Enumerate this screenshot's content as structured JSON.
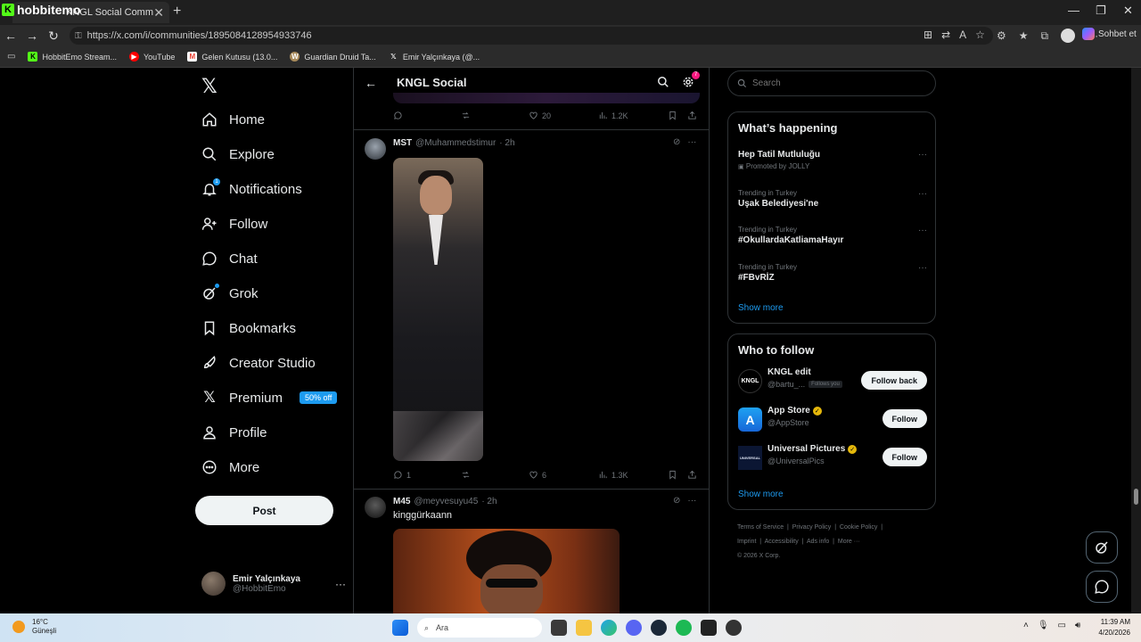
{
  "browser": {
    "channel_name": "hobbitemo",
    "tab_title": "KNGL Social Community / X",
    "url": "https://x.com/i/communities/1895084128954933746",
    "copilot_label": "Sohbet et",
    "bookmarks": [
      {
        "label": "HobbitEmo Stream...",
        "icon": "kick-icon",
        "color": "#53fc18"
      },
      {
        "label": "YouTube",
        "icon": "youtube-icon",
        "color": "#ff0000"
      },
      {
        "label": "Gelen Kutusu (13.0...",
        "icon": "gmail-icon",
        "color": "#ea4335"
      },
      {
        "label": "Guardian Druid Ta...",
        "icon": "wow-icon",
        "color": "#a88a5a"
      },
      {
        "label": "Emir Yalçınkaya (@...",
        "icon": "x-icon",
        "color": "#ffffff"
      }
    ]
  },
  "nav": {
    "items": [
      {
        "label": "Home",
        "icon": "home-icon"
      },
      {
        "label": "Explore",
        "icon": "search-icon"
      },
      {
        "label": "Notifications",
        "icon": "bell-icon",
        "badge": "1"
      },
      {
        "label": "Follow",
        "icon": "add-person-icon"
      },
      {
        "label": "Chat",
        "icon": "chat-bubble-icon"
      },
      {
        "label": "Grok",
        "icon": "grok-icon"
      },
      {
        "label": "Bookmarks",
        "icon": "bookmark-icon"
      },
      {
        "label": "Creator Studio",
        "icon": "rocket-icon"
      },
      {
        "label": "Premium",
        "icon": "x-premium-icon",
        "badge": "50% off"
      },
      {
        "label": "Profile",
        "icon": "person-icon"
      },
      {
        "label": "More",
        "icon": "more-circle-icon"
      }
    ],
    "post_label": "Post",
    "account": {
      "name": "Emir Yalçınkaya",
      "handle": "@HobbitEmo"
    }
  },
  "community": {
    "title": "KNGL Social",
    "settings_badge": "7"
  },
  "tweets": [
    {
      "actions": {
        "reply": "",
        "retweet": "",
        "like": "20",
        "views": "1.2K"
      }
    },
    {
      "name": "MST",
      "handle": "@Muhammedstimur",
      "time": "· 2h",
      "actions": {
        "reply": "1",
        "retweet": "",
        "like": "6",
        "views": "1.3K"
      }
    },
    {
      "name": "M45",
      "handle": "@meyvesuyu45",
      "time": "· 2h",
      "text": "kinggürkaann"
    }
  ],
  "right": {
    "search_placeholder": "Search",
    "happening_title": "What’s happening",
    "trends": [
      {
        "context": "Promoted by JOLLY",
        "title": "Hep Tatil Mutluluğu",
        "promoted": true
      },
      {
        "context": "Trending in Turkey",
        "title": "Uşak Belediyesi'ne"
      },
      {
        "context": "Trending in Turkey",
        "title": "#OkullardaKatliamaHayır"
      },
      {
        "context": "Trending in Turkey",
        "title": "#FBvRİZ"
      }
    ],
    "show_more": "Show more",
    "wtf_title": "Who to follow",
    "who_to_follow": [
      {
        "name": "KNGL edit",
        "handle": "@bartu_...",
        "follows_you": "Follows you",
        "button": "Follow back",
        "avatar_text": "KNGL",
        "verified": false
      },
      {
        "name": "App Store",
        "handle": "@AppStore",
        "button": "Follow",
        "verified": true
      },
      {
        "name": "Universal Pictures",
        "handle": "@UniversalPics",
        "button": "Follow",
        "avatar_text": "UNIVERSAL",
        "verified": true
      }
    ],
    "footer": [
      "Terms of Service",
      "Privacy Policy",
      "Cookie Policy",
      "Imprint",
      "Accessibility",
      "Ads info",
      "More ···",
      "© 2026 X Corp."
    ]
  },
  "taskbar": {
    "temp": "16°C",
    "weather": "Güneşli",
    "search_label": "Ara",
    "time": "11:39 AM",
    "date": "4/20/2026"
  }
}
